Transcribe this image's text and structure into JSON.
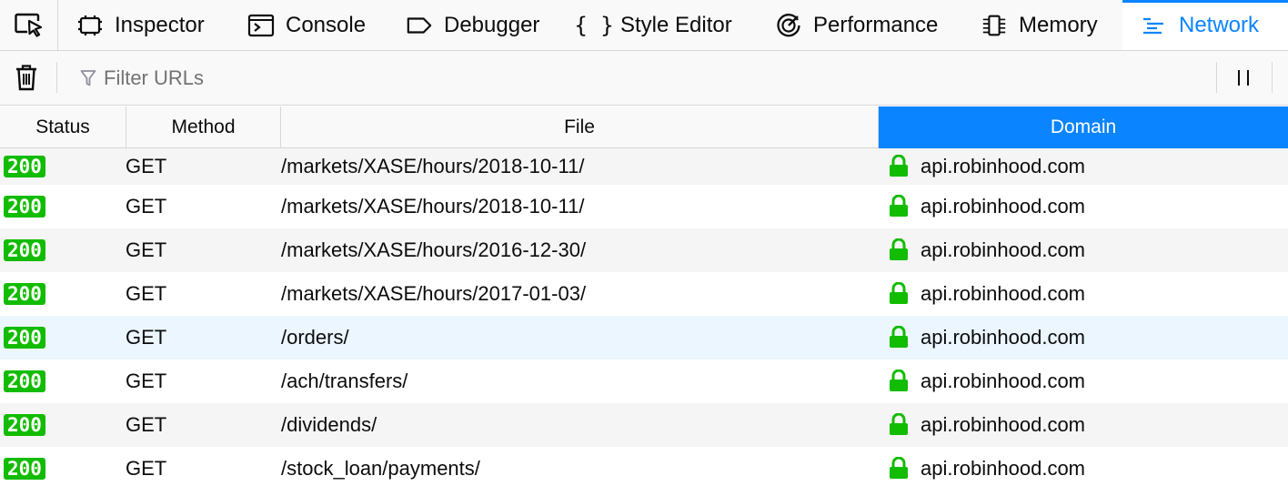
{
  "toolbox": {
    "tabs": [
      {
        "label": "Inspector",
        "icon": "inspector-icon"
      },
      {
        "label": "Console",
        "icon": "console-icon"
      },
      {
        "label": "Debugger",
        "icon": "debugger-icon"
      },
      {
        "label": "Style Editor",
        "icon": "style-editor-icon"
      },
      {
        "label": "Performance",
        "icon": "performance-icon"
      },
      {
        "label": "Memory",
        "icon": "memory-icon"
      },
      {
        "label": "Network",
        "icon": "network-icon",
        "selected": true
      }
    ],
    "accent_color": "#0a84ff"
  },
  "filter": {
    "placeholder": "Filter URLs",
    "value": ""
  },
  "columns": [
    "Status",
    "Method",
    "File",
    "Domain"
  ],
  "sorted_column": "Domain",
  "requests": [
    {
      "status": "200",
      "method": "GET",
      "file": "/markets/XASE/hours/2018-10-11/",
      "domain": "api.robinhood.com",
      "secure": true
    },
    {
      "status": "200",
      "method": "GET",
      "file": "/markets/XASE/hours/2018-10-11/",
      "domain": "api.robinhood.com",
      "secure": true
    },
    {
      "status": "200",
      "method": "GET",
      "file": "/markets/XASE/hours/2016-12-30/",
      "domain": "api.robinhood.com",
      "secure": true
    },
    {
      "status": "200",
      "method": "GET",
      "file": "/markets/XASE/hours/2017-01-03/",
      "domain": "api.robinhood.com",
      "secure": true
    },
    {
      "status": "200",
      "method": "GET",
      "file": "/orders/",
      "domain": "api.robinhood.com",
      "secure": true
    },
    {
      "status": "200",
      "method": "GET",
      "file": "/ach/transfers/",
      "domain": "api.robinhood.com",
      "secure": true
    },
    {
      "status": "200",
      "method": "GET",
      "file": "/dividends/",
      "domain": "api.robinhood.com",
      "secure": true
    },
    {
      "status": "200",
      "method": "GET",
      "file": "/stock_loan/payments/",
      "domain": "api.robinhood.com",
      "secure": true
    }
  ],
  "colors": {
    "status_ok": "#12bc00",
    "secure_lock": "#12bc00",
    "row_alt": "#f5f5f5",
    "row_hover": "#ebf6fe"
  }
}
